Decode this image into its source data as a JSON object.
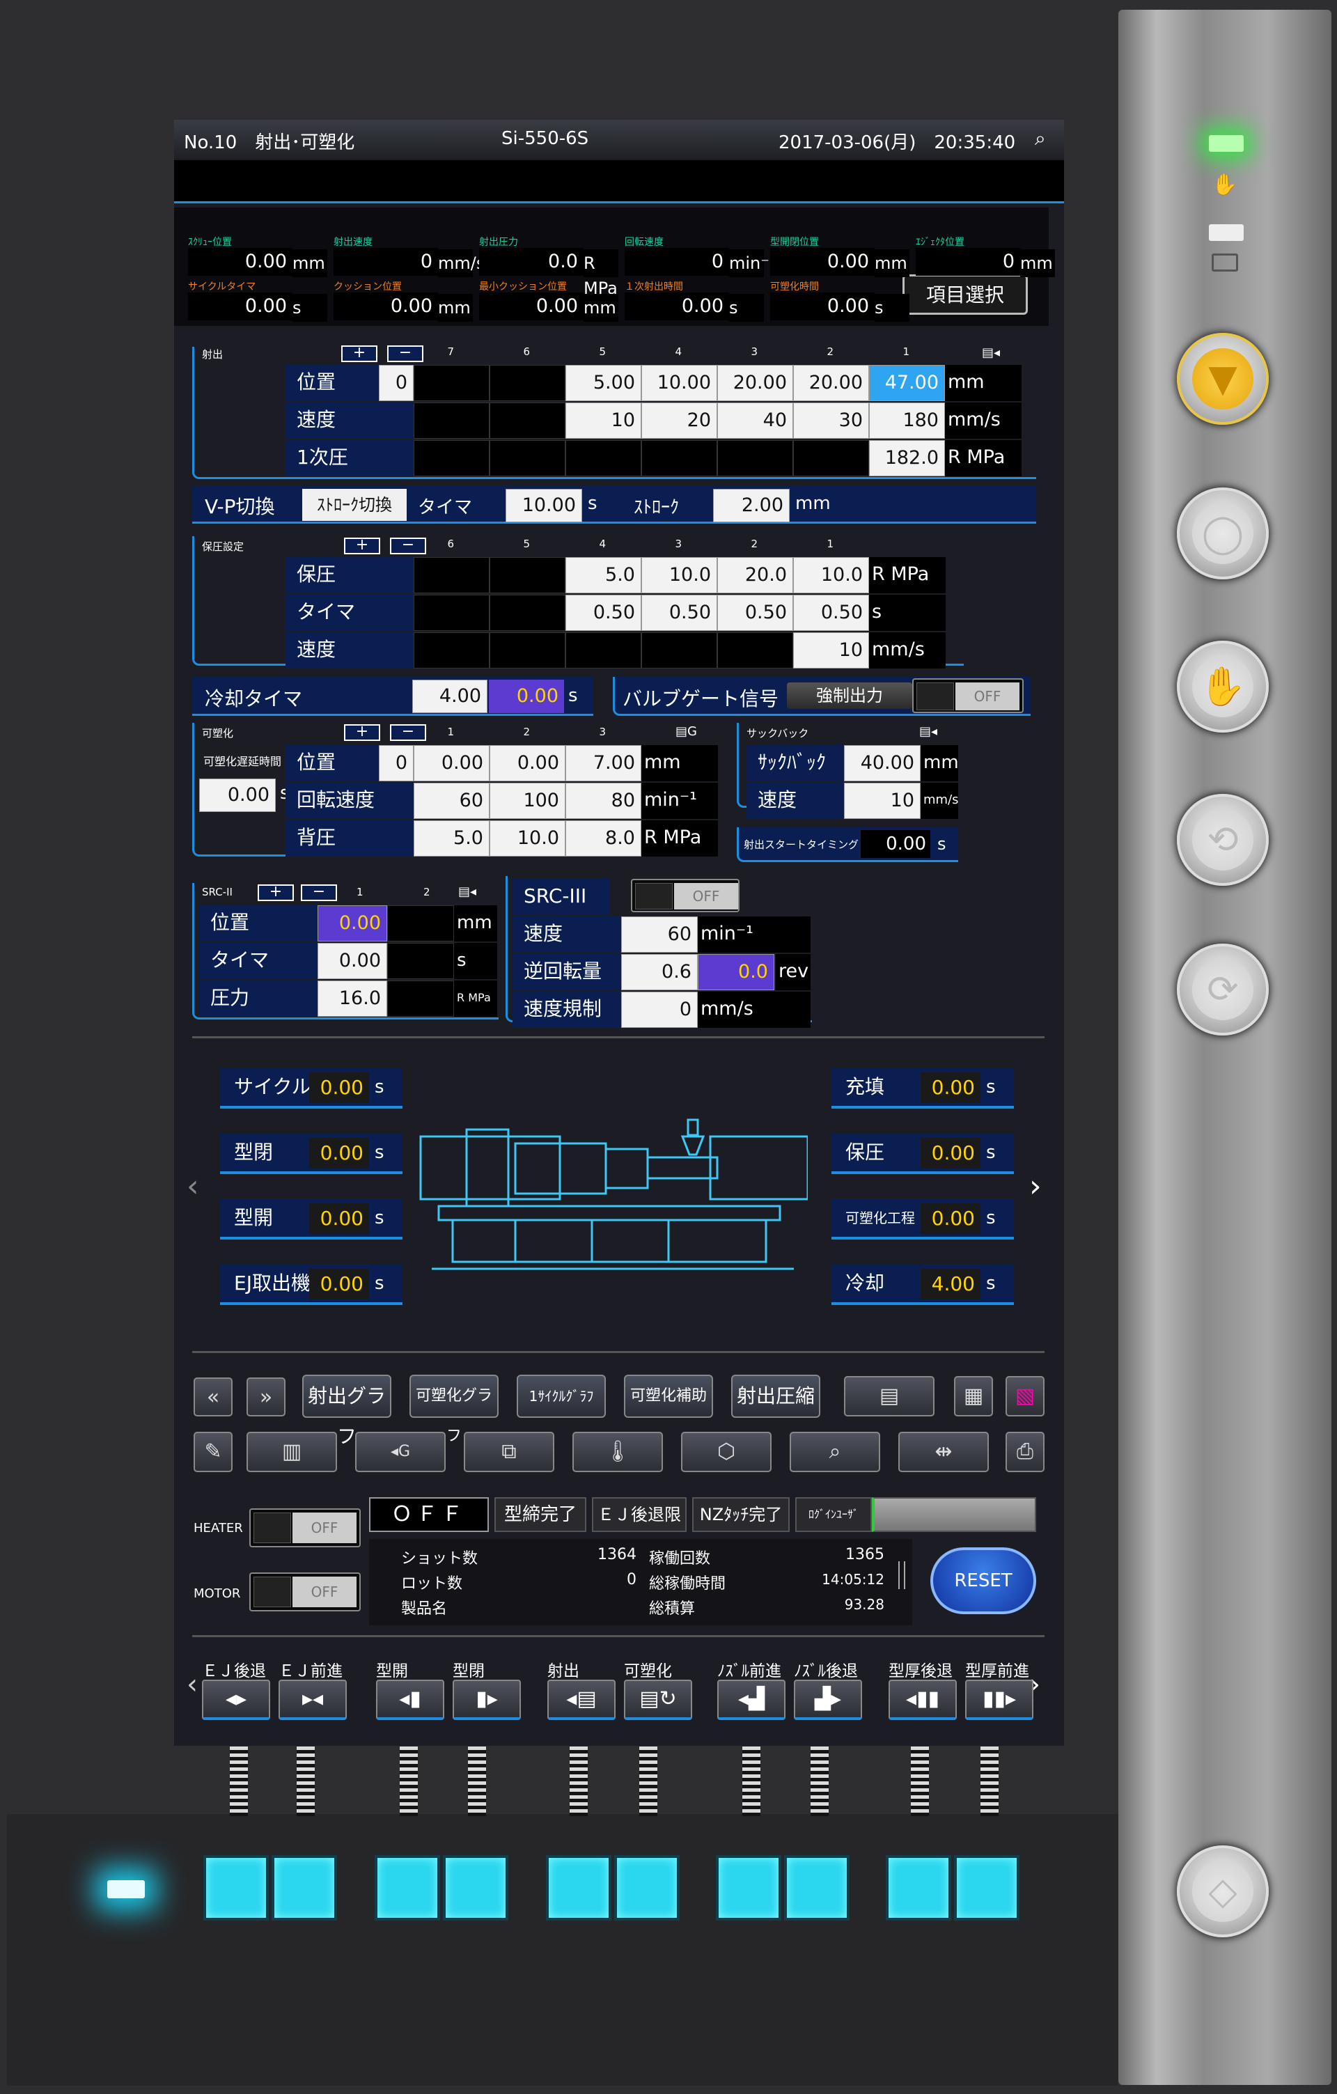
{
  "header": {
    "title": "No.10　射出･可塑化",
    "model": "Si-550-6S",
    "datetime": "2017-03-06(月)　20:35:40"
  },
  "monitor": {
    "row1": [
      {
        "label": "ｽｸﾘｭｰ位置",
        "value": "0.00",
        "unit": "mm"
      },
      {
        "label": "射出速度",
        "value": "0",
        "unit": "mm/s"
      },
      {
        "label": "射出圧力",
        "value": "0.0",
        "unit": "R MPa"
      },
      {
        "label": "回転速度",
        "value": "0",
        "unit": "min⁻¹"
      },
      {
        "label": "型開閉位置",
        "value": "0.00",
        "unit": "mm"
      },
      {
        "label": "ｴｼﾞｪｸﾀ位置",
        "value": "0",
        "unit": "mm"
      }
    ],
    "row2": [
      {
        "label": "サイクルタイマ",
        "value": "0.00",
        "unit": "s"
      },
      {
        "label": "クッション位置",
        "value": "0.00",
        "unit": "mm"
      },
      {
        "label": "最小クッション位置",
        "value": "0.00",
        "unit": "mm"
      },
      {
        "label": "１次射出時間",
        "value": "0.00",
        "unit": "s"
      },
      {
        "label": "可塑化時間",
        "value": "0.00",
        "unit": "s"
      }
    ],
    "select_button": "項目選択",
    "row1_color": "#1ad0a0",
    "row2_color": "#f08020"
  },
  "injection": {
    "title": "射出",
    "cols": [
      "7",
      "6",
      "5",
      "4",
      "3",
      "2",
      "1"
    ],
    "rows": [
      {
        "label": "位置",
        "first": "0",
        "values": [
          "",
          "",
          "5.00",
          "10.00",
          "20.00",
          "20.00",
          "47.00"
        ],
        "unit": "mm"
      },
      {
        "label": "速度",
        "values": [
          "",
          "",
          "10",
          "20",
          "40",
          "30",
          "180"
        ],
        "unit": "mm/s"
      },
      {
        "label": "1次圧",
        "values": [
          "",
          "",
          "",
          "",
          "",
          "",
          "182.0"
        ],
        "unit": "R MPa"
      }
    ]
  },
  "vp": {
    "label": "V-P切換",
    "mode": "ｽﾄﾛｰｸ切換",
    "timer_label": "タイマ",
    "timer_value": "10.00",
    "timer_unit": "s",
    "stroke_label": "ｽﾄﾛｰｸ",
    "stroke_value": "2.00",
    "stroke_unit": "mm"
  },
  "hold": {
    "title": "保圧設定",
    "cols": [
      "6",
      "5",
      "4",
      "3",
      "2",
      "1"
    ],
    "rows": [
      {
        "label": "保圧",
        "values": [
          "",
          "",
          "5.0",
          "10.0",
          "20.0",
          "10.0"
        ],
        "unit": "R MPa"
      },
      {
        "label": "タイマ",
        "values": [
          "",
          "",
          "0.50",
          "0.50",
          "0.50",
          "0.50"
        ],
        "unit": "s"
      },
      {
        "label": "速度",
        "values": [
          "",
          "",
          "",
          "",
          "",
          "10"
        ],
        "unit": "mm/s"
      }
    ]
  },
  "cooling": {
    "label": "冷却タイマ",
    "value": "4.00",
    "value2": "0.00",
    "unit": "s"
  },
  "valve": {
    "label": "バルブゲート信号",
    "force": "強制出力",
    "toggle": "OFF"
  },
  "plast": {
    "title": "可塑化",
    "delay_label": "可塑化遅延時間",
    "delay_value": "0.00",
    "delay_unit": "s",
    "cols": [
      "1",
      "2",
      "3"
    ],
    "rows": [
      {
        "label": "位置",
        "first": "0",
        "values": [
          "0.00",
          "0.00",
          "7.00"
        ],
        "unit": "mm"
      },
      {
        "label": "回転速度",
        "values": [
          "60",
          "100",
          "80"
        ],
        "unit": "min⁻¹"
      },
      {
        "label": "背圧",
        "values": [
          "5.0",
          "10.0",
          "8.0"
        ],
        "unit": "R MPa"
      }
    ]
  },
  "suckback": {
    "title": "サックバック",
    "rows": [
      {
        "label": "ｻｯｸﾊﾞｯｸ幅",
        "value": "40.00",
        "unit": "mm"
      },
      {
        "label": "速度",
        "value": "10",
        "unit": "mm/s"
      }
    ],
    "start_label": "射出スタートタイミング",
    "start_value": "0.00",
    "start_unit": "s"
  },
  "src2": {
    "title": "SRC-II",
    "cols": [
      "1",
      "2"
    ],
    "rows": [
      {
        "label": "位置",
        "value": "0.00",
        "unit": "mm"
      },
      {
        "label": "タイマ",
        "value": "0.00",
        "unit": "s"
      },
      {
        "label": "圧力",
        "value": "16.0",
        "unit": "R MPa"
      }
    ]
  },
  "src3": {
    "title": "SRC-III",
    "toggle": "OFF",
    "rows": [
      {
        "label": "速度",
        "value": "60",
        "unit": "min⁻¹"
      },
      {
        "label": "逆回転量",
        "value": "0.6",
        "value2": "0.0",
        "unit": "rev"
      },
      {
        "label": "速度規制",
        "value": "0",
        "unit": "mm/s"
      }
    ]
  },
  "times_left": [
    {
      "label": "サイクル",
      "value": "0.00",
      "unit": "s"
    },
    {
      "label": "型閉",
      "value": "0.00",
      "unit": "s"
    },
    {
      "label": "型開",
      "value": "0.00",
      "unit": "s"
    },
    {
      "label": "EJ取出機",
      "value": "0.00",
      "unit": "s"
    }
  ],
  "times_right": [
    {
      "label": "充填",
      "value": "0.00",
      "unit": "s"
    },
    {
      "label": "保圧",
      "value": "0.00",
      "unit": "s"
    },
    {
      "label": "可塑化工程",
      "value": "0.00",
      "unit": "s"
    },
    {
      "label": "冷却",
      "value": "4.00",
      "unit": "s"
    }
  ],
  "toolbar1": [
    "射出グラフ",
    "可塑化グラフ",
    "1ｻｲｸﾙｸﾞﾗﾌ",
    "可塑化補助",
    "射出圧縮"
  ],
  "status": {
    "heater_label": "HEATER",
    "heater_toggle": "OFF",
    "motor_label": "MOTOR",
    "motor_toggle": "OFF",
    "off_text": "ＯＦＦ",
    "mold_closed": "型締完了",
    "ej_back": "ＥＪ後退限",
    "nz_touch": "NZﾀｯﾁ完了",
    "login_label": "ﾛｸﾞｲﾝﾕｰｻﾞ",
    "shot_label": "ショット数",
    "shot_value": "1364",
    "lot_label": "ロット数",
    "lot_value": "0",
    "product_label": "製品名",
    "run_label": "稼働回数",
    "run_value": "1365",
    "runtime_label": "総稼働時間",
    "runtime_value": "14:05:12",
    "total_label": "総積算",
    "total_value": "93.28",
    "reset": "RESET"
  },
  "jog": [
    {
      "label": "ＥＪ後退",
      "icon": "◂▸"
    },
    {
      "label": "ＥＪ前進",
      "icon": "▸◂"
    },
    {
      "label": "型開",
      "icon": "◂▮"
    },
    {
      "label": "型閉",
      "icon": "▮▸"
    },
    {
      "label": "射出",
      "icon": "◂▤"
    },
    {
      "label": "可塑化",
      "icon": "▤↻"
    },
    {
      "label": "ﾉｽﾞﾙ前進",
      "icon": "◂▟"
    },
    {
      "label": "ﾉｽﾞﾙ後退",
      "icon": "▟▸"
    },
    {
      "label": "型厚後退",
      "icon": "◂▮▮"
    },
    {
      "label": "型厚前進",
      "icon": "▮▮▸"
    }
  ],
  "colors": {
    "panel_blue": "#0b1e52",
    "accent_blue": "#1d8fe0",
    "value_yellow": "#ffd400",
    "highlight_purple": "#5b3bd0",
    "selected_cyan": "#2fa4f0",
    "led_cyan": "#2bd6ef"
  }
}
